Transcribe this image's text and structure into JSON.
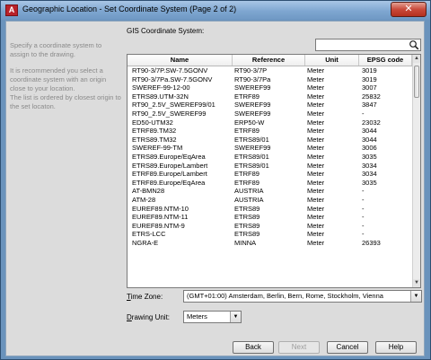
{
  "window": {
    "title": "Geographic Location - Set Coordinate System (Page 2 of 2)",
    "app_icon_letter": "A",
    "close_glyph": "✕"
  },
  "help": {
    "para1": "Specify a coordinate system to assign to the drawing.",
    "para2": "It is recommended you select a coordinate system with an origin close to your location.\nThe list is ordered by closest origin to the set locaton."
  },
  "gis": {
    "label": "GIS Coordinate System:",
    "search_value": "",
    "search_icon": "search-icon"
  },
  "table": {
    "columns": [
      "Name",
      "Reference",
      "Unit",
      "EPSG code"
    ],
    "rows": [
      [
        "RT90-3/7P.SW-7.5GONV",
        "RT90-3/7P",
        "Meter",
        "3019"
      ],
      [
        "RT90-3/7Pa.SW-7.5GONV",
        "RT90-3/7Pa",
        "Meter",
        "3019"
      ],
      [
        "SWEREF-99-12-00",
        "SWEREF99",
        "Meter",
        "3007"
      ],
      [
        "ETRS89.UTM-32N",
        "ETRF89",
        "Meter",
        "25832"
      ],
      [
        "RT90_2.5V_SWEREF99/01",
        "SWEREF99",
        "Meter",
        "3847"
      ],
      [
        "RT90_2.5V_SWEREF99",
        "SWEREF99",
        "Meter",
        "-"
      ],
      [
        "ED50-UTM32",
        "ERP50-W",
        "Meter",
        "23032"
      ],
      [
        "ETRF89.TM32",
        "ETRF89",
        "Meter",
        "3044"
      ],
      [
        "ETRS89.TM32",
        "ETRS89/01",
        "Meter",
        "3044"
      ],
      [
        "SWEREF-99-TM",
        "SWEREF99",
        "Meter",
        "3006"
      ],
      [
        "ETRS89.Europe/EqArea",
        "ETRS89/01",
        "Meter",
        "3035"
      ],
      [
        "ETRS89.Europe/Lambert",
        "ETRS89/01",
        "Meter",
        "3034"
      ],
      [
        "ETRF89.Europe/Lambert",
        "ETRF89",
        "Meter",
        "3034"
      ],
      [
        "ETRF89.Europe/EqArea",
        "ETRF89",
        "Meter",
        "3035"
      ],
      [
        "AT-BMN28",
        "AUSTRIA",
        "Meter",
        "-"
      ],
      [
        "ATM-28",
        "AUSTRIA",
        "Meter",
        "-"
      ],
      [
        "EUREF89.NTM-10",
        "ETRS89",
        "Meter",
        "-"
      ],
      [
        "EUREF89.NTM-11",
        "ETRS89",
        "Meter",
        "-"
      ],
      [
        "EUREF89.NTM-9",
        "ETRS89",
        "Meter",
        "-"
      ],
      [
        "ETRS-LCC",
        "ETRS89",
        "Meter",
        "-"
      ],
      [
        "NGRA-E",
        "MINNA",
        "Meter",
        "26393"
      ],
      [
        "",
        "",
        "",
        ""
      ]
    ]
  },
  "timezone": {
    "label_prefix": "",
    "label_accel": "T",
    "label_rest": "ime Zone:",
    "value": "(GMT+01:00) Amsterdam, Berlin, Bern, Rome, Stockholm, Vienna"
  },
  "drawing_unit": {
    "label_accel": "D",
    "label_rest": "rawing Unit:",
    "value": "Meters"
  },
  "buttons": {
    "back": "Back",
    "next": "Next",
    "cancel": "Cancel",
    "help": "Help"
  }
}
